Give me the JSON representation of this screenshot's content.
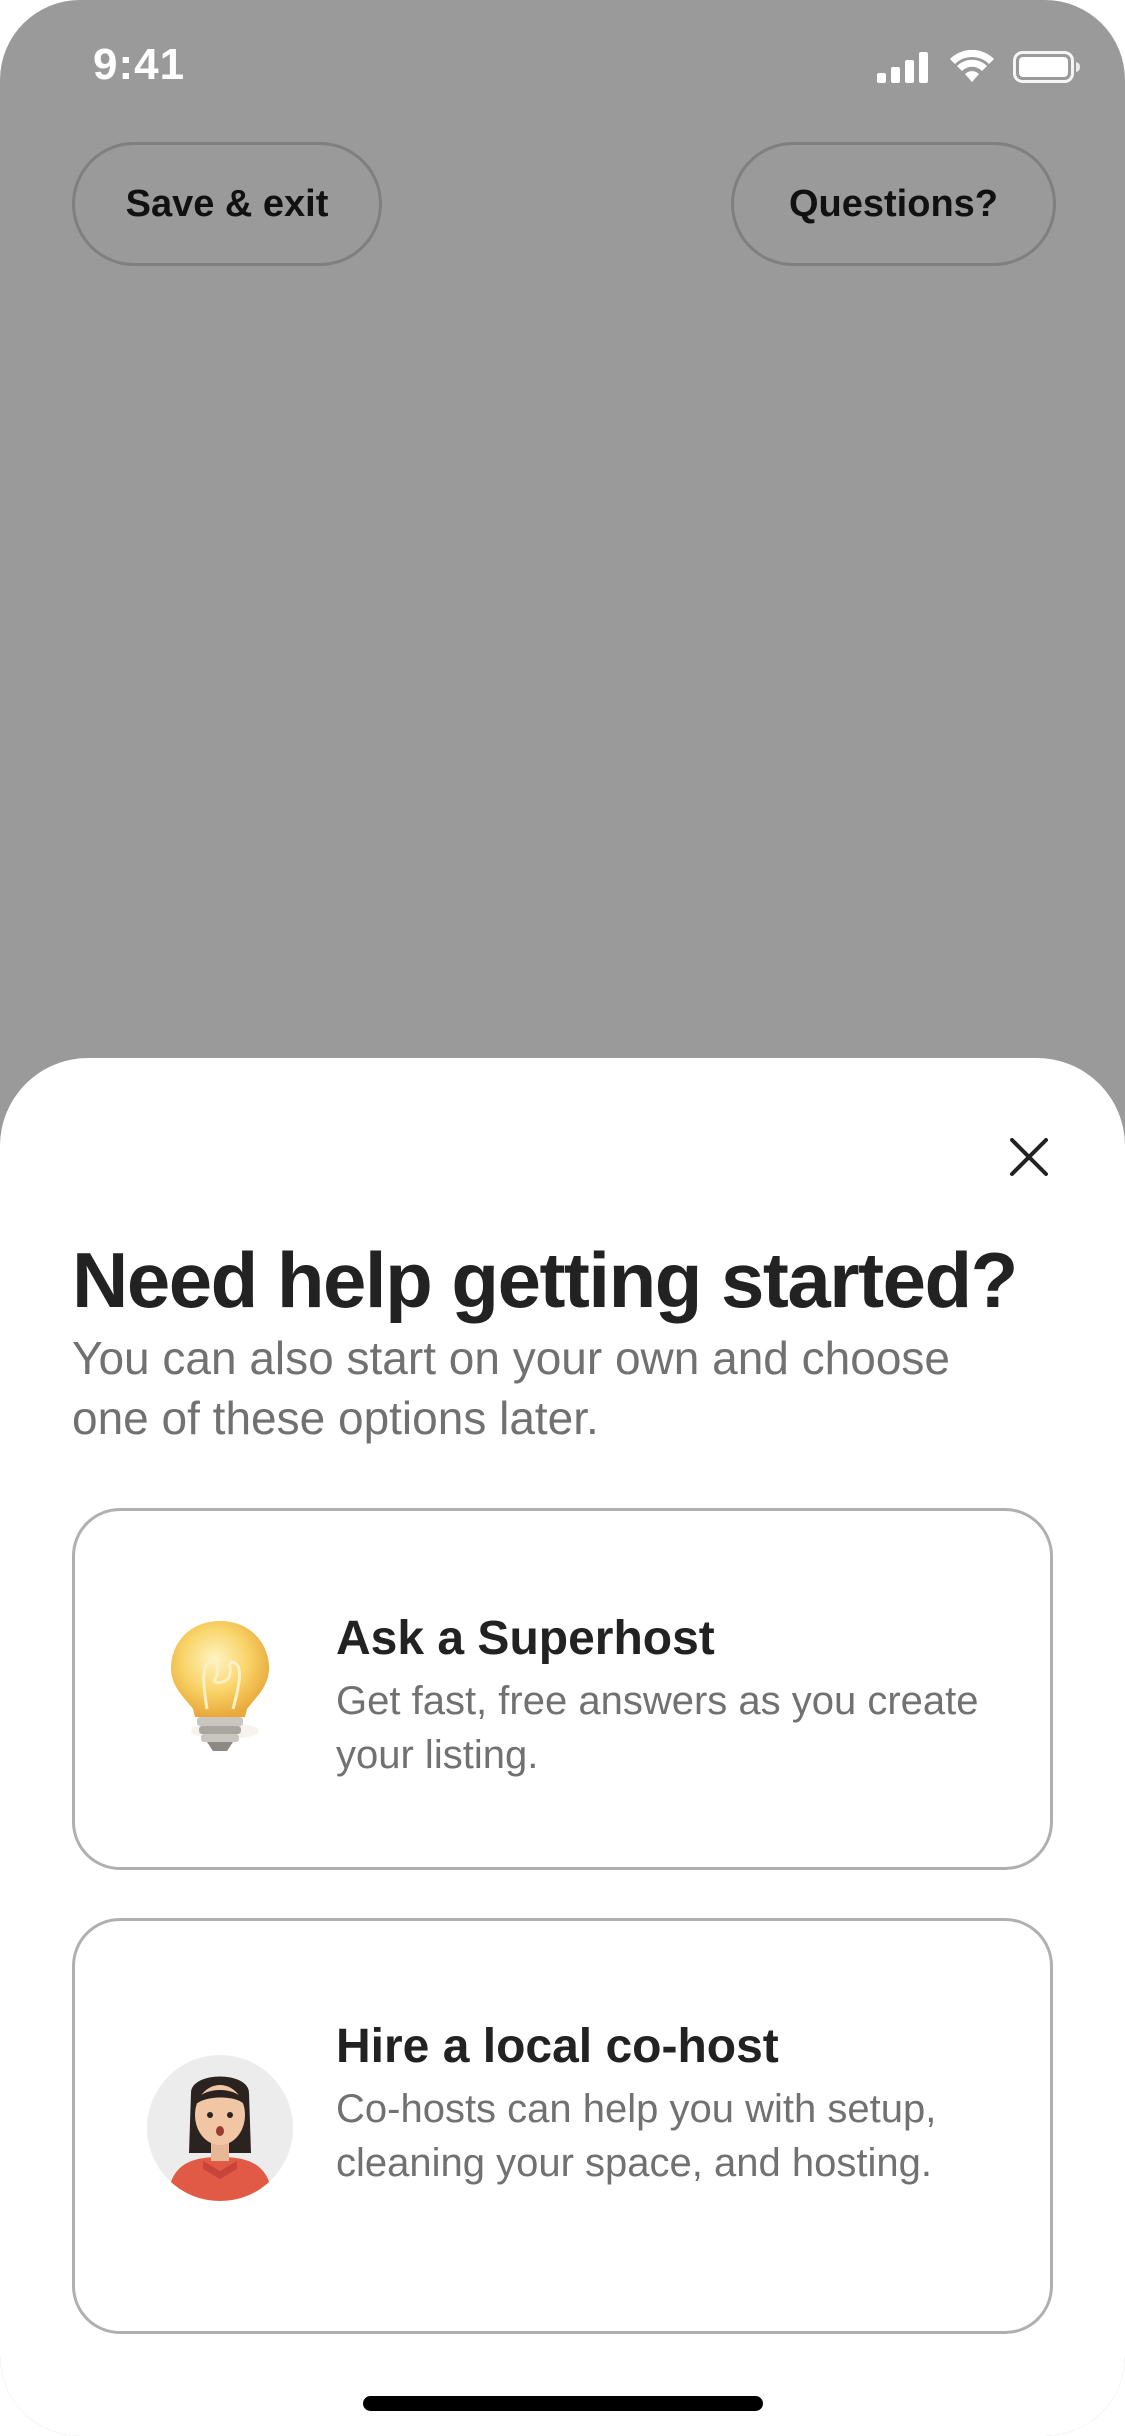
{
  "status_bar": {
    "time": "9:41",
    "icons": [
      "signal-icon",
      "wifi-icon",
      "battery-icon"
    ]
  },
  "top_bar": {
    "save_exit_label": "Save & exit",
    "questions_label": "Questions?"
  },
  "sheet": {
    "title": "Need help getting started?",
    "subtitle": "You can also start on your own and choose one of these options later.",
    "close_icon": "close-icon",
    "options": [
      {
        "icon": "lightbulb-icon",
        "title": "Ask a Superhost",
        "description": "Get fast, free answers as you create your listing."
      },
      {
        "icon": "cohost-avatar-icon",
        "title": "Hire a local co-host",
        "description": "Co-hosts can help you with setup, cleaning your space, and hosting."
      }
    ]
  },
  "colors": {
    "overlay_background": "#9a9a9a",
    "sheet_background": "#ffffff",
    "title_text": "#222222",
    "secondary_text": "#717171",
    "card_border": "#b0b0b0"
  }
}
